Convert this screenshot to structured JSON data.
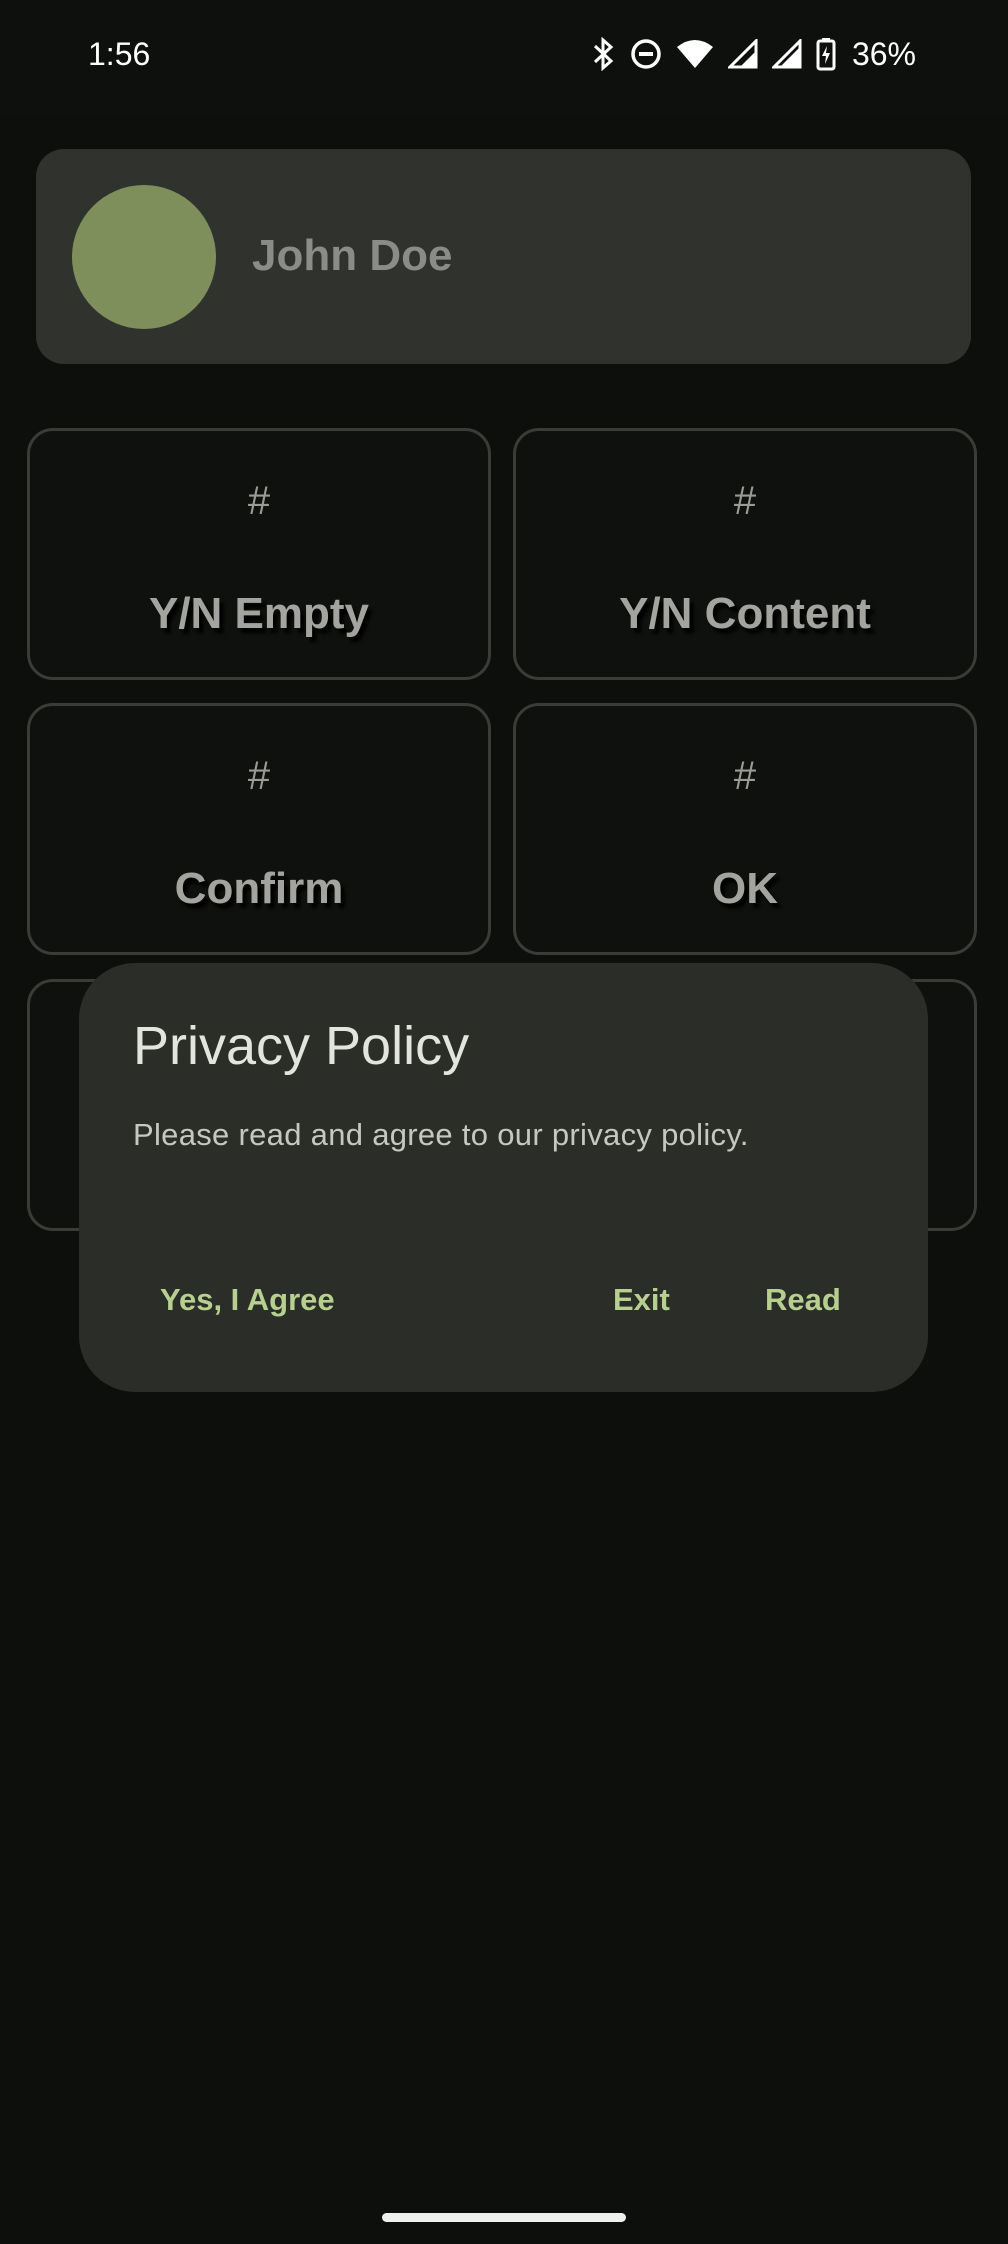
{
  "status_bar": {
    "time": "1:56",
    "battery": "36%",
    "icons": [
      "bluetooth-icon",
      "do-not-disturb-icon",
      "wifi-icon",
      "signal-icon",
      "signal-icon",
      "battery-charging-icon"
    ]
  },
  "profile": {
    "name": "John Doe",
    "avatar_color": "#7e8f5c"
  },
  "tiles": [
    {
      "icon": "#",
      "label": "Y/N Empty"
    },
    {
      "icon": "#",
      "label": "Y/N Content"
    },
    {
      "icon": "#",
      "label": "Confirm"
    },
    {
      "icon": "#",
      "label": "OK"
    }
  ],
  "dialog": {
    "title": "Privacy Policy",
    "message": "Please read and agree to our privacy policy.",
    "buttons": {
      "agree": "Yes, I Agree",
      "exit": "Exit",
      "read": "Read"
    },
    "accent_color": "#b7cf8f"
  }
}
